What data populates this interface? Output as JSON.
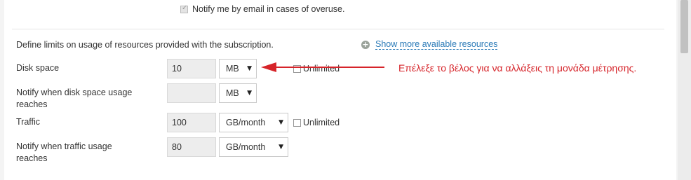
{
  "notify_overuse": {
    "label": "Notify me by email in cases of overuse.",
    "checked": true
  },
  "section_description": "Define limits on usage of resources provided with the subscription.",
  "more_resources_link": "Show more available resources",
  "rows": {
    "disk_space": {
      "label": "Disk space",
      "value": "10",
      "unit": "MB",
      "unlimited_label": "Unlimited",
      "unlimited_checked": false
    },
    "disk_notify": {
      "label": "Notify when disk space usage reaches",
      "value": "",
      "unit": "MB"
    },
    "traffic": {
      "label": "Traffic",
      "value": "100",
      "unit": "GB/month",
      "unlimited_label": "Unlimited",
      "unlimited_checked": false
    },
    "traffic_notify": {
      "label": "Notify when traffic usage reaches",
      "value": "80",
      "unit": "GB/month"
    }
  },
  "annotation": {
    "text": "Επέλεξε το βέλος για να αλλάξεις τη μονάδα μέτρησης.",
    "color": "#d6242a"
  },
  "icons": {
    "dropdown": "triangle-down-icon",
    "expand": "plus-circle-icon",
    "arrow": "red-left-arrow"
  }
}
